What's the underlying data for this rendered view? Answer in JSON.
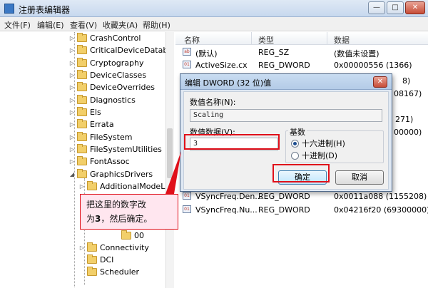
{
  "window": {
    "title": "注册表编辑器",
    "controls": {
      "minimize": "—",
      "maximize": "□",
      "close": "✕"
    }
  },
  "menu": [
    "文件(F)",
    "编辑(E)",
    "查看(V)",
    "收藏夹(A)",
    "帮助(H)"
  ],
  "tree": {
    "items": [
      {
        "label": "CrashControl",
        "expandable": true
      },
      {
        "label": "CriticalDeviceDatabase",
        "expandable": true
      },
      {
        "label": "Cryptography",
        "expandable": true
      },
      {
        "label": "DeviceClasses",
        "expandable": true
      },
      {
        "label": "DeviceOverrides",
        "expandable": true
      },
      {
        "label": "Diagnostics",
        "expandable": true
      },
      {
        "label": "Els",
        "expandable": true
      },
      {
        "label": "Errata",
        "expandable": true
      },
      {
        "label": "FileSystem",
        "expandable": true
      },
      {
        "label": "FileSystemUtilities",
        "expandable": true
      },
      {
        "label": "FontAssoc",
        "expandable": true
      },
      {
        "label": "GraphicsDrivers",
        "expandable": true,
        "expanded": true
      },
      {
        "label": "AdditionalModeLis",
        "expandable": true
      },
      {
        "label": "00",
        "expandable": false
      },
      {
        "label": "Connectivity",
        "expandable": true
      },
      {
        "label": "DCI",
        "expandable": false
      },
      {
        "label": "Scheduler",
        "expandable": false
      }
    ]
  },
  "list": {
    "columns": [
      "名称",
      "类型",
      "数据"
    ],
    "rows": [
      {
        "name": "(默认)",
        "type": "REG_SZ",
        "data": "(数值未设置)"
      },
      {
        "name": "ActiveSize.cx",
        "type": "REG_DWORD",
        "data": "0x00000556 (1366)"
      },
      {
        "name": "",
        "type": "",
        "data": "8)"
      },
      {
        "name": "",
        "type": "",
        "data": "08167)"
      },
      {
        "name": "",
        "type": "",
        "data": "271)"
      },
      {
        "name": "",
        "type": "",
        "data": "00000)"
      },
      {
        "name": "VSyncFreq.Den...",
        "type": "REG_DWORD",
        "data": "0x0011a088 (1155208)"
      },
      {
        "name": "VSyncFreq.Nu...",
        "type": "REG_DWORD",
        "data": "0x04216f20 (69300000)"
      }
    ]
  },
  "dialog": {
    "title": "编辑 DWORD (32 位)值",
    "close": "✕",
    "value_name_label": "数值名称(N):",
    "value_name": "Scaling",
    "value_data_label": "数值数据(V):",
    "value_data": "3",
    "base_label": "基数",
    "base_options": [
      {
        "label": "十六进制(H)",
        "selected": true
      },
      {
        "label": "十进制(D)",
        "selected": false
      }
    ],
    "ok_label": "确定",
    "cancel_label": "取消"
  },
  "callout": {
    "line1": "把这里的数字改",
    "line2_prefix": "为",
    "line2_number": "3",
    "line2_suffix": "，然后确定。"
  },
  "colors": {
    "highlight_red": "#e0101a",
    "callout_bg": "#ffe6ef",
    "dialog_bg": "#dfe8f3"
  }
}
